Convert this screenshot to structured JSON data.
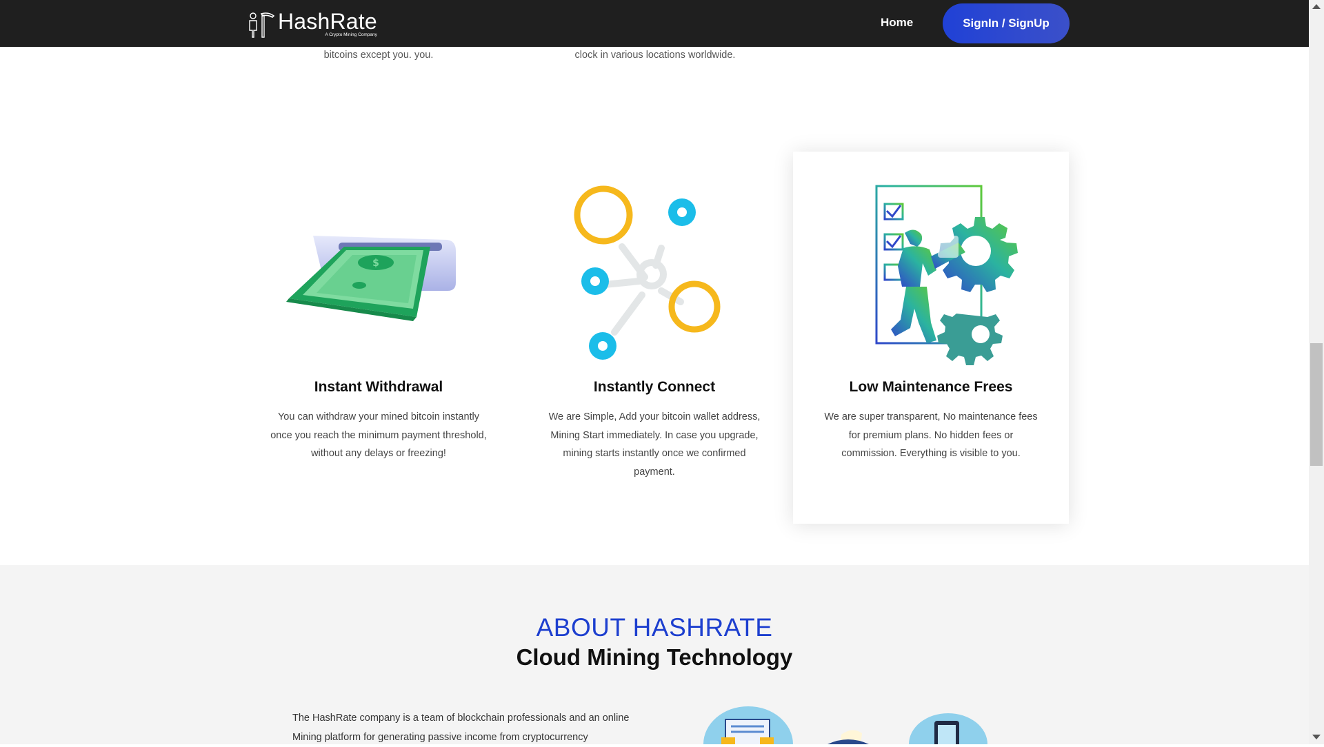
{
  "header": {
    "brand_name": "HashRate",
    "brand_tagline": "A Crypto Mining Company",
    "nav_home": "Home",
    "nav_signin": "SignIn / SignUp"
  },
  "fragments": {
    "left": "bitcoins except you. you.",
    "middle": "clock in various locations worldwide."
  },
  "features": [
    {
      "title": "Instant Withdrawal",
      "text": "You can withdraw your mined bitcoin instantly once you reach the minimum payment threshold, without any delays or freezing!",
      "icon": "cash-withdrawal-icon"
    },
    {
      "title": "Instantly Connect",
      "text": "We are Simple, Add your bitcoin wallet address, Mining Start immediately. In case you upgrade, mining starts instantly once we confirmed payment.",
      "icon": "network-connect-icon"
    },
    {
      "title": "Low Maintenance Frees",
      "text": "We are super transparent, No maintenance fees for premium plans. No hidden fees or commission. Everything is visible to you.",
      "icon": "maintenance-gear-icon"
    }
  ],
  "about": {
    "kicker": "ABOUT HASHRATE",
    "title": "Cloud Mining Technology",
    "text": "The HashRate company is a team of blockchain professionals and an online Mining platform for generating passive income from cryptocurrency"
  },
  "colors": {
    "header_bg": "#1f1f1f",
    "accent_blue": "#1d3fcf",
    "about_bg": "#f4f4f4"
  }
}
